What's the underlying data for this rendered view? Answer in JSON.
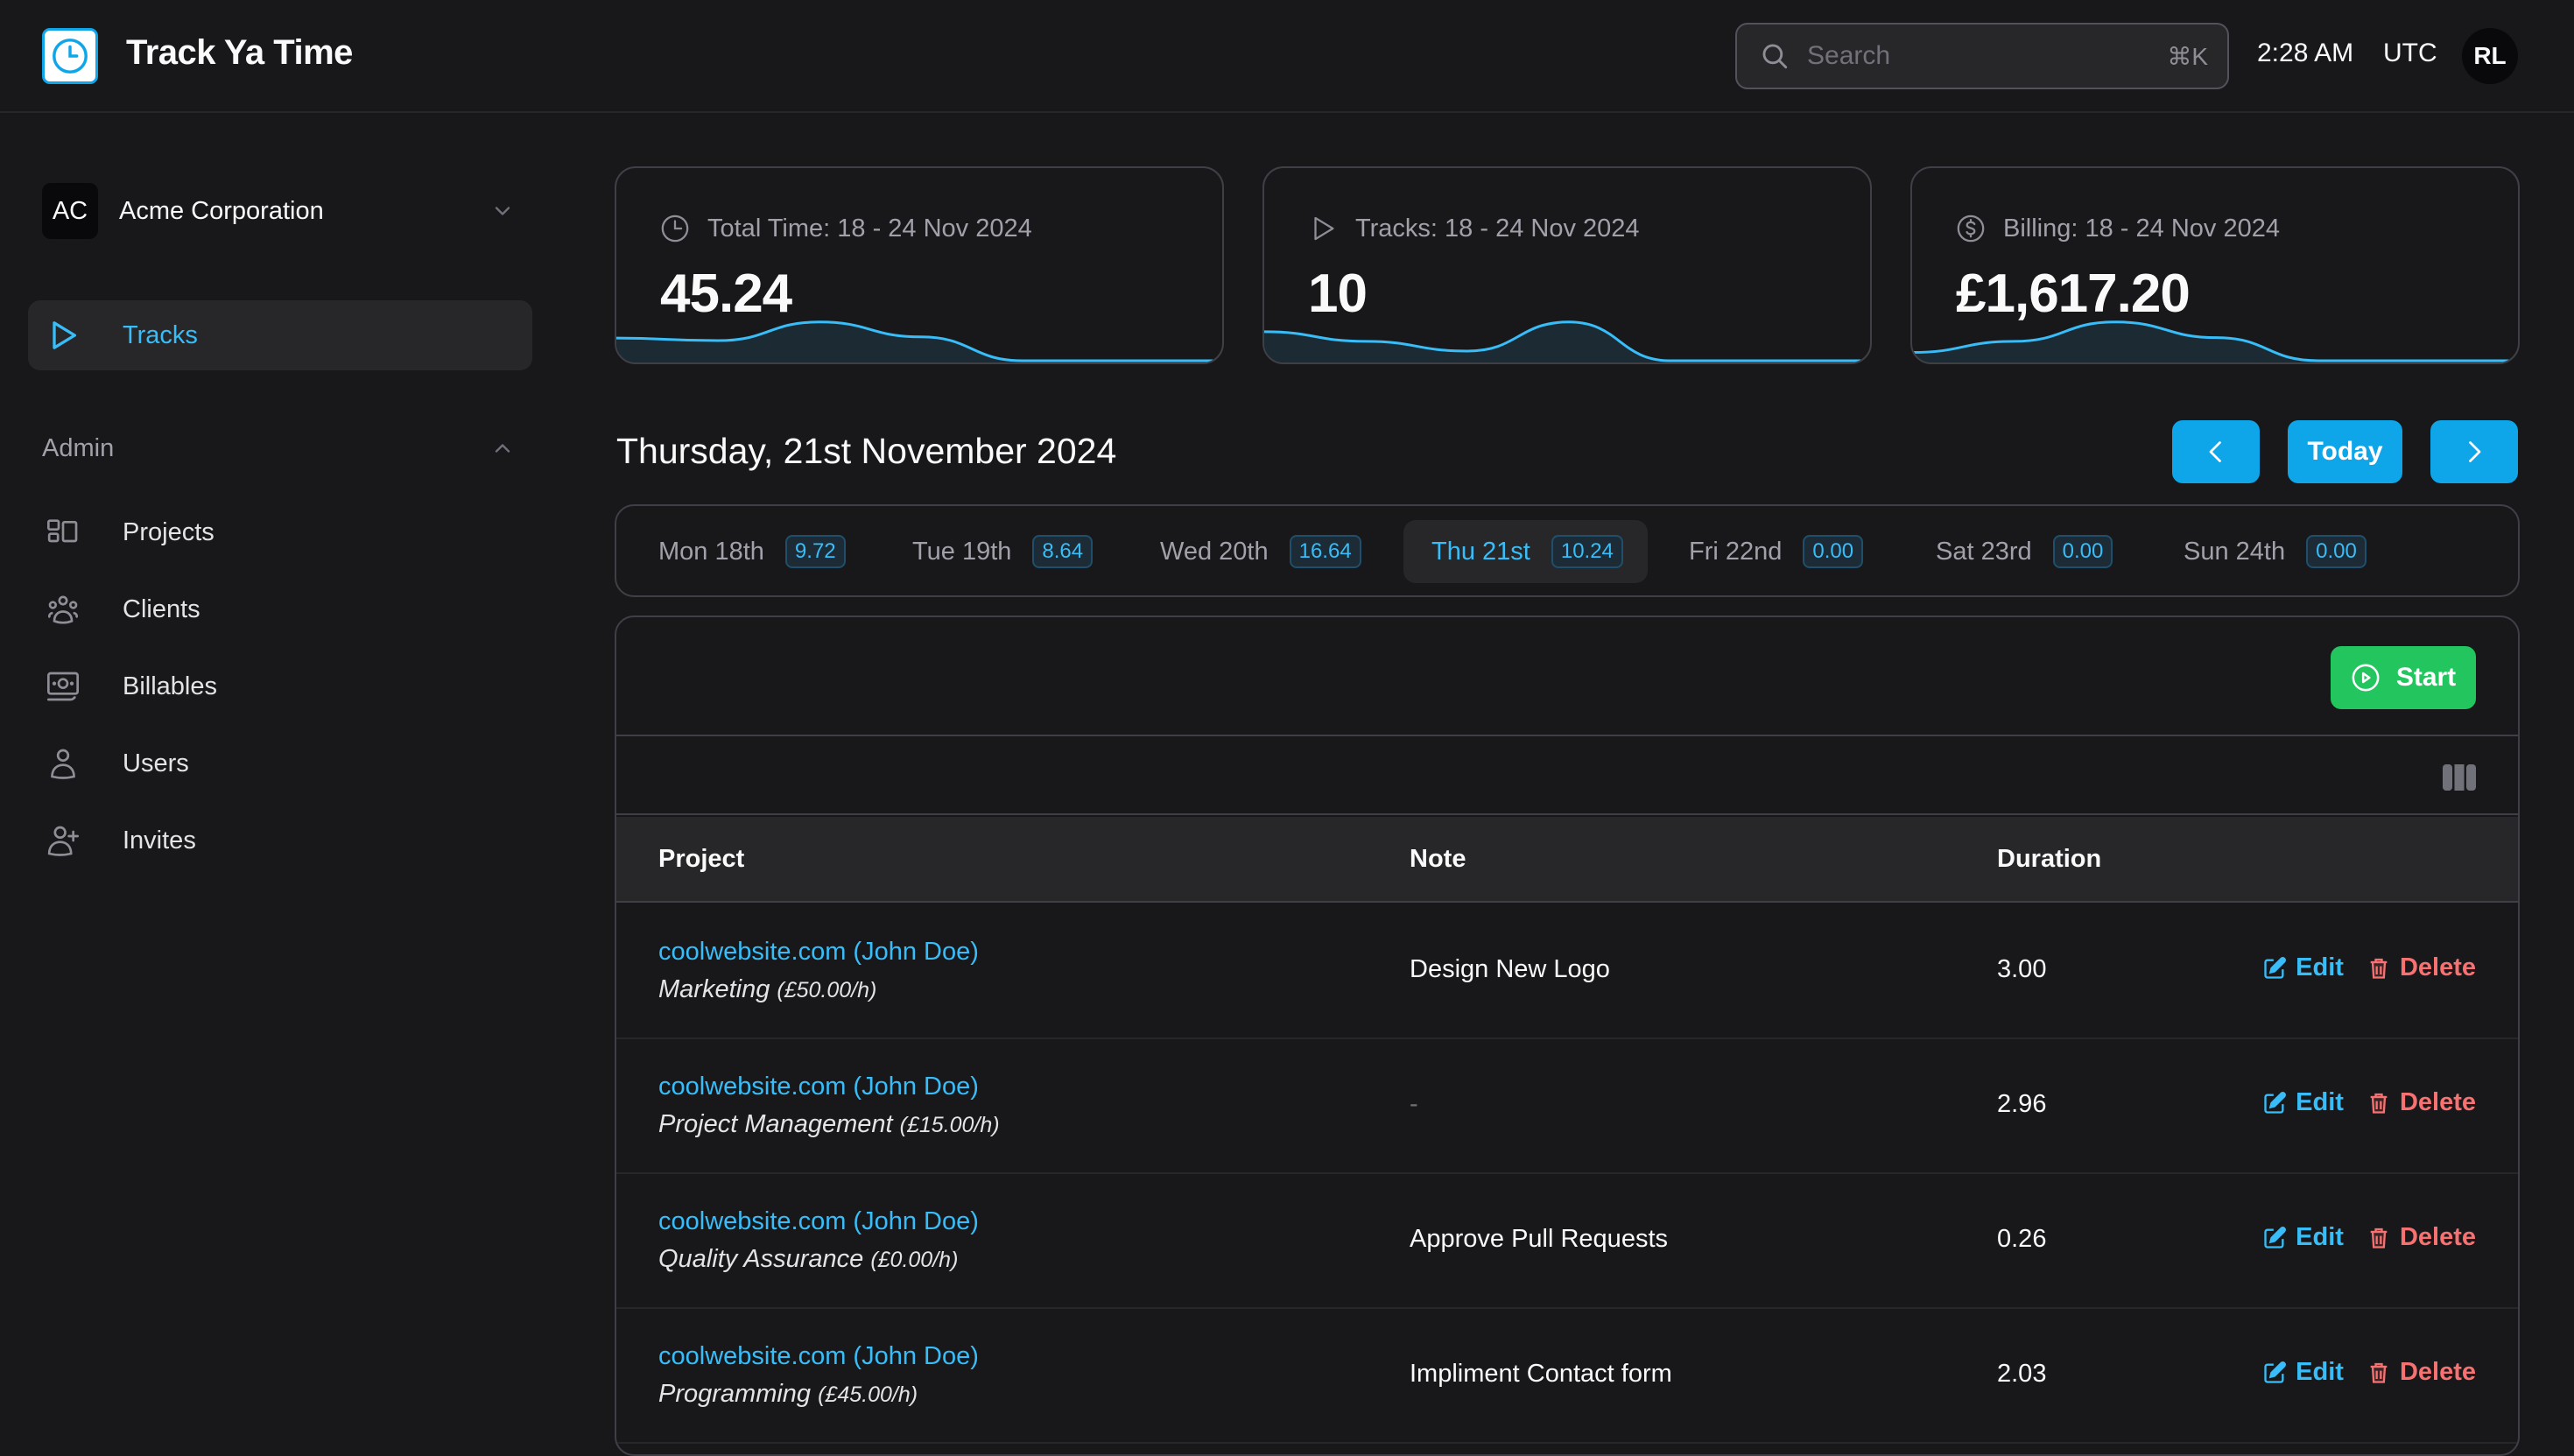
{
  "app": {
    "title": "Track Ya Time",
    "logo_icon": "clock-icon"
  },
  "header": {
    "search_placeholder": "Search",
    "search_shortcut": "⌘K",
    "time": "2:28 AM",
    "timezone": "UTC",
    "user_initials": "RL"
  },
  "sidebar": {
    "org": {
      "initials": "AC",
      "name": "Acme Corporation"
    },
    "main_items": [
      {
        "label": "Tracks",
        "icon": "play-icon",
        "active": true
      }
    ],
    "admin_section": {
      "label": "Admin",
      "expanded": true,
      "items": [
        {
          "label": "Projects",
          "icon": "projects-icon"
        },
        {
          "label": "Clients",
          "icon": "clients-icon"
        },
        {
          "label": "Billables",
          "icon": "billables-icon"
        },
        {
          "label": "Users",
          "icon": "user-icon"
        },
        {
          "label": "Invites",
          "icon": "user-plus-icon"
        }
      ]
    }
  },
  "stats": [
    {
      "label": "Total Time: 18 - 24 Nov 2024",
      "value": "45.24",
      "icon": "clock-icon"
    },
    {
      "label": "Tracks: 18 - 24 Nov 2024",
      "value": "10",
      "icon": "play-icon"
    },
    {
      "label": "Billing: 18 - 24 Nov 2024",
      "value": "£1,617.20",
      "icon": "dollar-circle-icon"
    }
  ],
  "sparklines": {
    "days": [
      "Mon",
      "Tue",
      "Wed",
      "Thu",
      "Fri",
      "Sat",
      "Sun"
    ],
    "total_time": [
      9.72,
      8.64,
      16.64,
      10.24,
      0,
      0,
      0
    ],
    "tracks": [
      3,
      2,
      1,
      4,
      0,
      0,
      0
    ],
    "billing": [
      150,
      350,
      700,
      417.2,
      0,
      0,
      0
    ]
  },
  "date_heading": "Thursday, 21st November 2024",
  "nav": {
    "prev_label": "‹",
    "today_label": "Today",
    "next_label": "›"
  },
  "days": [
    {
      "label": "Mon 18th",
      "hours": "9.72",
      "active": false
    },
    {
      "label": "Tue 19th",
      "hours": "8.64",
      "active": false
    },
    {
      "label": "Wed 20th",
      "hours": "16.64",
      "active": false
    },
    {
      "label": "Thu 21st",
      "hours": "10.24",
      "active": true
    },
    {
      "label": "Fri 22nd",
      "hours": "0.00",
      "active": false
    },
    {
      "label": "Sat 23rd",
      "hours": "0.00",
      "active": false
    },
    {
      "label": "Sun 24th",
      "hours": "0.00",
      "active": false
    }
  ],
  "tracks_table": {
    "start_label": "Start",
    "columns": [
      "Project",
      "Note",
      "Duration"
    ],
    "edit_label": "Edit",
    "delete_label": "Delete",
    "rows": [
      {
        "project": "coolwebsite.com (John Doe)",
        "task": "Marketing",
        "rate": "(£50.00/h)",
        "note": "Design New Logo",
        "duration": "3.00"
      },
      {
        "project": "coolwebsite.com (John Doe)",
        "task": "Project Management",
        "rate": "(£15.00/h)",
        "note": "-",
        "duration": "2.96"
      },
      {
        "project": "coolwebsite.com (John Doe)",
        "task": "Quality Assurance",
        "rate": "(£0.00/h)",
        "note": "Approve Pull Requests",
        "duration": "0.26"
      },
      {
        "project": "coolwebsite.com (John Doe)",
        "task": "Programming",
        "rate": "(£45.00/h)",
        "note": "Impliment Contact form",
        "duration": "2.03"
      }
    ]
  },
  "colors": {
    "background": "#18181b",
    "accent": "#0ea5e9",
    "accent_text": "#38bdf8",
    "success": "#22c55e",
    "danger": "#f87171",
    "border": "#3f3f46"
  }
}
